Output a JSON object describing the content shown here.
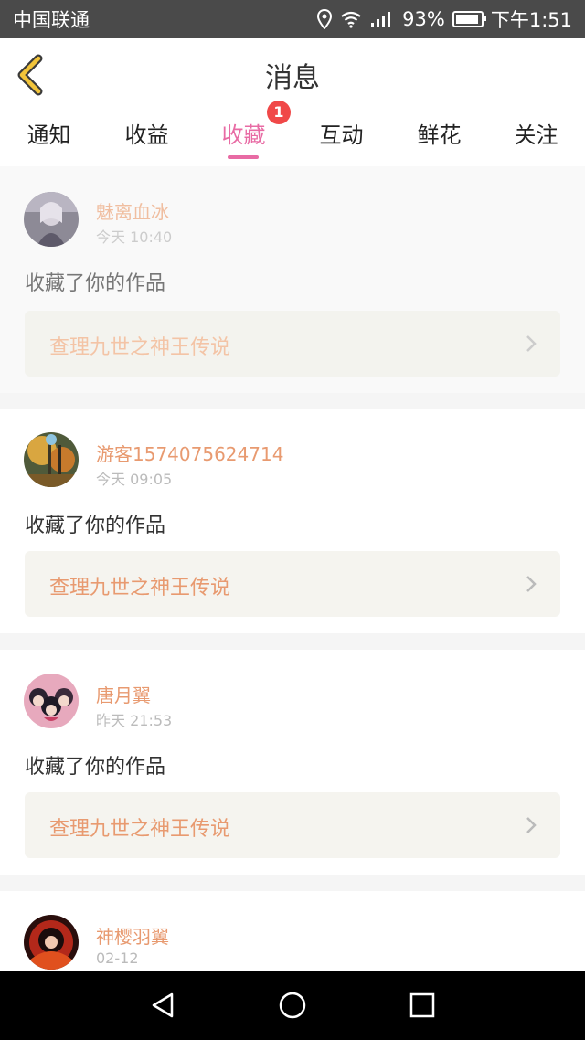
{
  "status_bar": {
    "carrier": "中国联通",
    "battery": "93%",
    "battery_level": 0.93,
    "time": "下午1:51"
  },
  "header": {
    "title": "消息"
  },
  "tabs": [
    {
      "label": "通知",
      "active": false
    },
    {
      "label": "收益",
      "active": false
    },
    {
      "label": "收藏",
      "active": true,
      "badge": "1"
    },
    {
      "label": "互动",
      "active": false
    },
    {
      "label": "鲜花",
      "active": false
    },
    {
      "label": "关注",
      "active": false
    }
  ],
  "messages": [
    {
      "user": "魅离血冰",
      "time": "今天 10:40",
      "action": "收藏了你的作品",
      "work": "查理九世之神王传说",
      "avatar": "avatar-grey-anime"
    },
    {
      "user": "游客1574075624714",
      "time": "今天 09:05",
      "action": "收藏了你的作品",
      "work": "查理九世之神王传说",
      "avatar": "avatar-autumn-forest"
    },
    {
      "user": "唐月翼",
      "time": "昨天 21:53",
      "action": "收藏了你的作品",
      "work": "查理九世之神王传说",
      "avatar": "avatar-anime-trio"
    },
    {
      "user": "神樱羽翼",
      "time": "02-12",
      "action": "",
      "work": "",
      "avatar": "avatar-red-anime"
    }
  ],
  "colors": {
    "accent": "#e86ba4",
    "username": "#e89a70",
    "badge": "#f04848"
  },
  "icons": {
    "back": "chevron-left-icon",
    "work_link": "chevron-right-icon",
    "nav_back": "triangle-back-icon",
    "nav_home": "circle-home-icon",
    "nav_recent": "square-recent-icon"
  }
}
